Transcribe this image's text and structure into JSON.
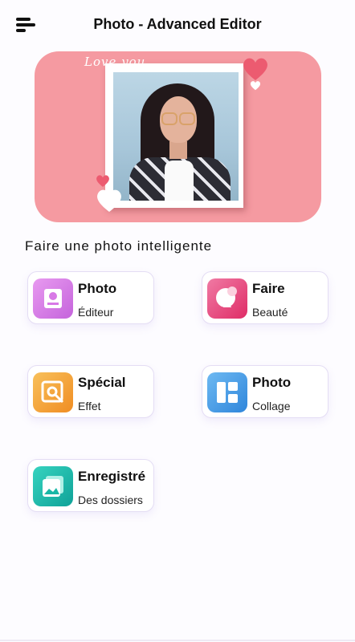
{
  "header": {
    "title": "Photo - Advanced Editor"
  },
  "banner": {
    "love_text": "Love you"
  },
  "section": {
    "heading": "Faire une photo intelligente"
  },
  "cards": [
    {
      "title": "Photo",
      "subtitle": "Éditeur",
      "icon": "photo-editor-icon",
      "color": "#d879e6"
    },
    {
      "title": "Faire",
      "subtitle": "Beauté",
      "icon": "beauty-face-icon",
      "color": "#e9437d"
    },
    {
      "title": "Spécial",
      "subtitle": "Effet",
      "icon": "special-effect-icon",
      "color": "#f5a236"
    },
    {
      "title": "Photo",
      "subtitle": "Collage",
      "icon": "collage-grid-icon",
      "color": "#3f9be6"
    },
    {
      "title": "Enregistré",
      "subtitle": "Des dossiers",
      "icon": "saved-folders-icon",
      "color": "#19b7a6"
    }
  ],
  "colors": {
    "banner": "#f59aa1",
    "accent_heart": "#ec5b70"
  }
}
